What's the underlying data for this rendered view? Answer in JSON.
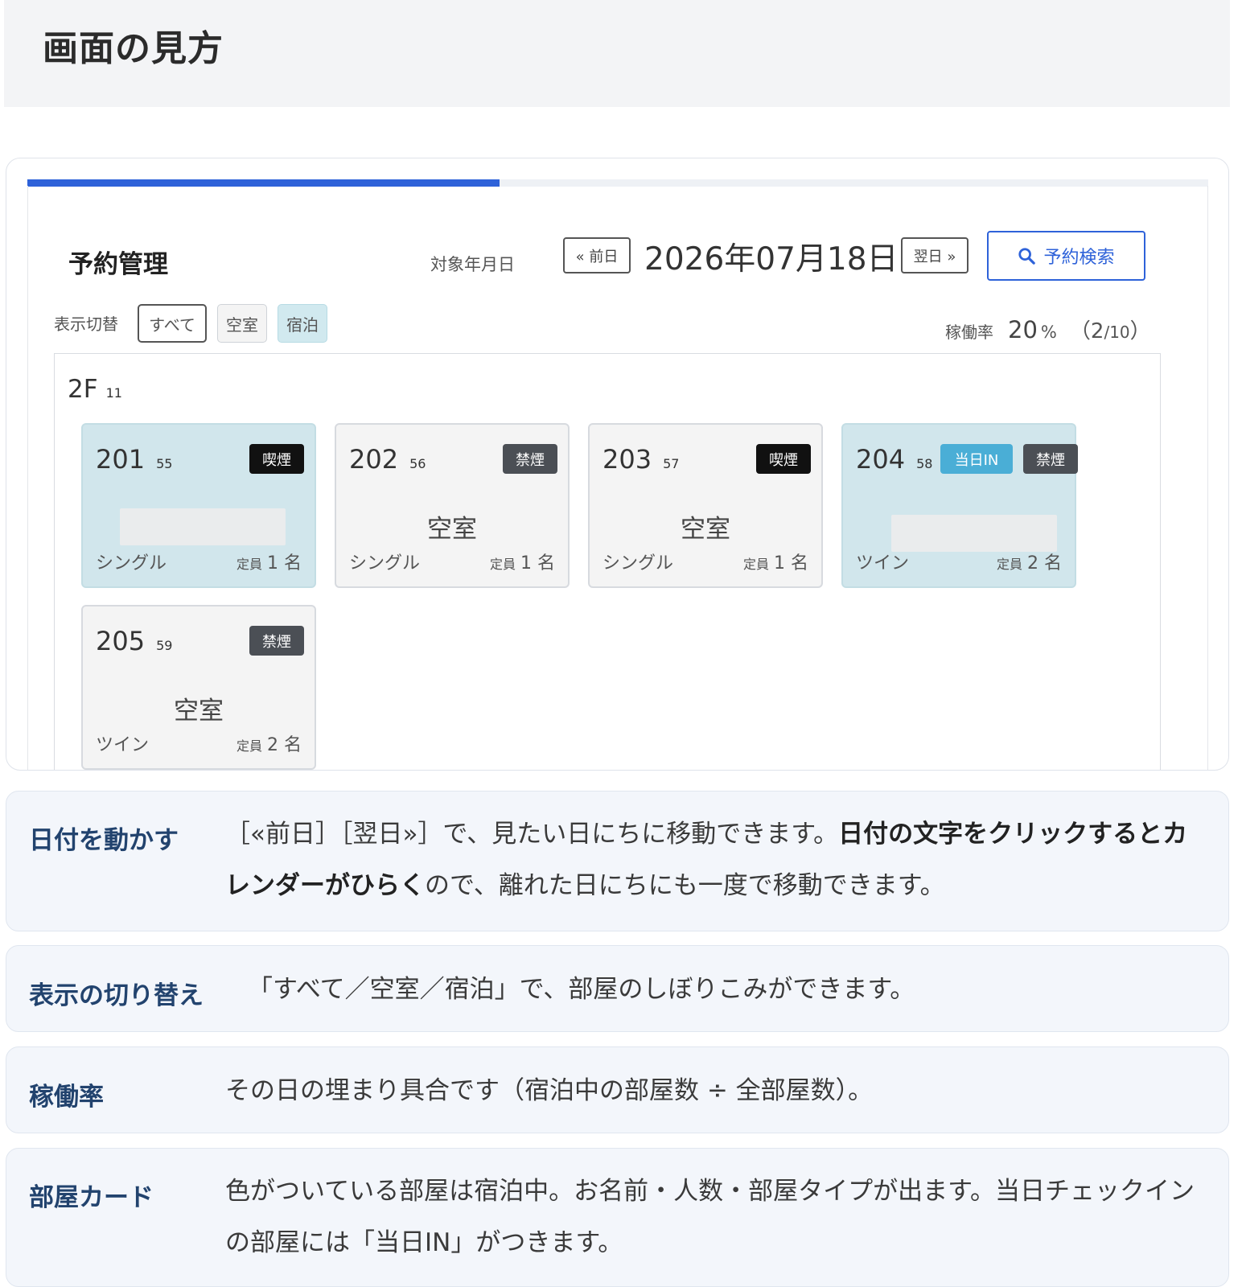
{
  "page": {
    "title": "画面の見方"
  },
  "screenshot": {
    "progress_percent": 40,
    "app_title": "予約管理",
    "date_label": "対象年月日",
    "prev_button": "« 前日",
    "next_button": "翌日 »",
    "date": "2026年07月18日",
    "search_button": "予約検索",
    "filter": {
      "label": "表示切替",
      "options": [
        "すべて",
        "空室",
        "宿泊"
      ],
      "selected": "すべて"
    },
    "occupancy": {
      "label": "稼働率",
      "rate": "20",
      "unit": "%",
      "paren_open": "（",
      "occupied": "2",
      "sep": "/",
      "total": "10",
      "paren_close": "）"
    },
    "floor": {
      "name": "2F",
      "count": "11"
    },
    "capacity_label": "定員",
    "person_unit": "名",
    "rooms": [
      {
        "number": "201",
        "id": "55",
        "smoking": "喫煙",
        "today_in": "",
        "status": "",
        "type": "シングル",
        "capacity": "1",
        "occupied": true
      },
      {
        "number": "202",
        "id": "56",
        "smoking": "禁煙",
        "today_in": "",
        "status": "空室",
        "type": "シングル",
        "capacity": "1",
        "occupied": false
      },
      {
        "number": "203",
        "id": "57",
        "smoking": "喫煙",
        "today_in": "",
        "status": "空室",
        "type": "シングル",
        "capacity": "1",
        "occupied": false
      },
      {
        "number": "204",
        "id": "58",
        "smoking": "禁煙",
        "today_in": "当日IN",
        "status": "",
        "type": "ツイン",
        "capacity": "2",
        "occupied": true
      },
      {
        "number": "205",
        "id": "59",
        "smoking": "禁煙",
        "today_in": "",
        "status": "空室",
        "type": "ツイン",
        "capacity": "2",
        "occupied": false
      }
    ]
  },
  "explanations": [
    {
      "title": "日付を動かす",
      "text_1": "［«前日］［翌日»］で、見たい日にちに移動できます。",
      "text_bold": "日付の文字をクリックするとカレンダーがひらく",
      "text_2": "ので、離れた日にちにも一度で移動できます。"
    },
    {
      "title": "表示の切り替え",
      "text": "「すべて／空室／宿泊」で、部屋のしぼりこみができます。"
    },
    {
      "title": "稼働率",
      "text": "その日の埋まり具合です（宿泊中の部屋数 ÷ 全部屋数）。"
    },
    {
      "title": "部屋カード",
      "text": "色がついている部屋は宿泊中。お名前・人数・部屋タイプが出ます。当日チェックインの部屋には「当日IN」がつきます。"
    }
  ],
  "colors": {
    "accent": "#2e62d9",
    "occupied_card": "#d1e6ec",
    "vacant_card": "#f4f4f4",
    "today_badge": "#4aaed6",
    "heading": "#22436e"
  }
}
